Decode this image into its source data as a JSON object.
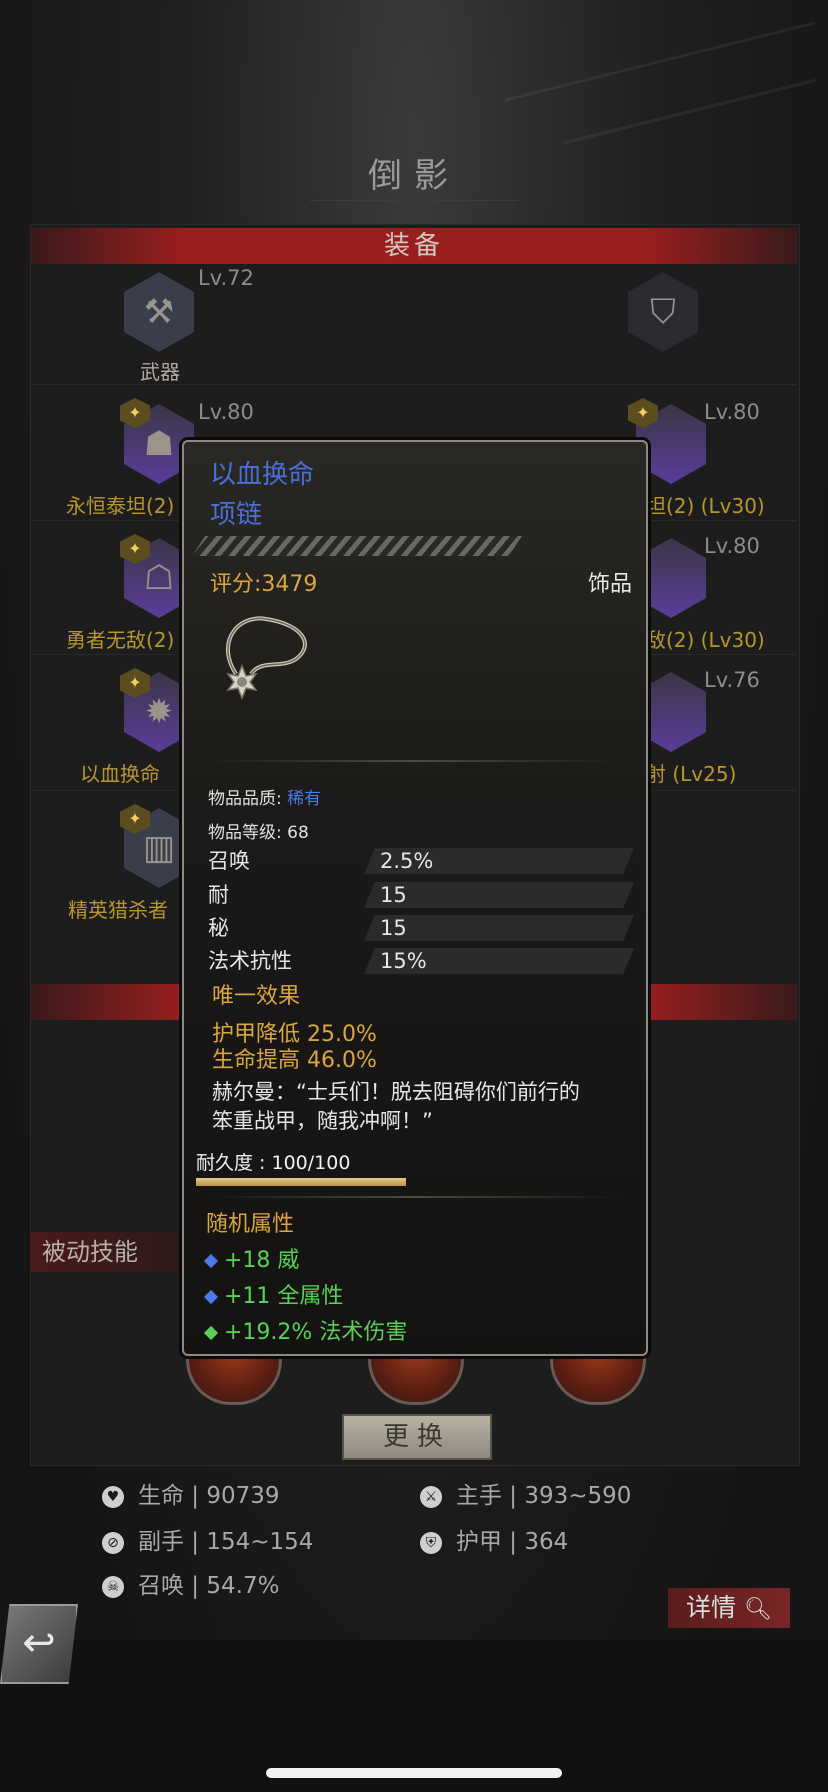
{
  "page": {
    "title": "倒影"
  },
  "sections": {
    "equipment_header": "装备",
    "passive_label": "被动技能"
  },
  "slots": [
    {
      "level": "Lv.72",
      "name": "武器"
    },
    {
      "level": "Lv.80",
      "name": "永恒泰坦(2)"
    },
    {
      "level": "Lv.80",
      "name": "勇者无敌(2)"
    },
    {
      "level": "",
      "name": "以血换命"
    },
    {
      "level": "",
      "name": "精英猎杀者"
    },
    {
      "level": "Lv.80",
      "name": "坦(2) (Lv30)"
    },
    {
      "level": "Lv.80",
      "name": "敌(2) (Lv30)"
    },
    {
      "level": "Lv.76",
      "name": "射 (Lv25)"
    }
  ],
  "tooltip": {
    "name": "以血换命",
    "type": "项链",
    "score": "评分:3479",
    "category": "饰品",
    "quality_label": "物品品质: ",
    "quality_value": "稀有",
    "item_level": "物品等级: 68",
    "stats": [
      {
        "label": "召唤",
        "value": "2.5%"
      },
      {
        "label": "耐",
        "value": "15"
      },
      {
        "label": "秘",
        "value": "15"
      },
      {
        "label": "法术抗性",
        "value": "15%"
      }
    ],
    "unique_title": "唯一效果",
    "unique_effects": [
      "护甲降低 25.0%",
      "生命提高 46.0%"
    ],
    "quote_line1": "赫尔曼：“士兵们！脱去阻碍你们前行的",
    "quote_line2": "笨重战甲，随我冲啊！”",
    "durability": "耐久度 : 100/100",
    "durability_fraction": 1.0,
    "random_title": "随机属性",
    "random_attrs": [
      "+18 威",
      "+11 全属性",
      "+19.2% 法术伤害"
    ]
  },
  "swap_button": "更换",
  "character_stats": [
    {
      "icon": "heart-icon",
      "text": "生命 | 90739"
    },
    {
      "icon": "sword-icon",
      "text": "主手 | 393~590"
    },
    {
      "icon": "offhand-icon",
      "text": "副手 | 154~154"
    },
    {
      "icon": "shield-icon",
      "text": "护甲 | 364"
    },
    {
      "icon": "summon-icon",
      "text": "召唤 | 54.7%"
    }
  ],
  "details_button": "详情"
}
